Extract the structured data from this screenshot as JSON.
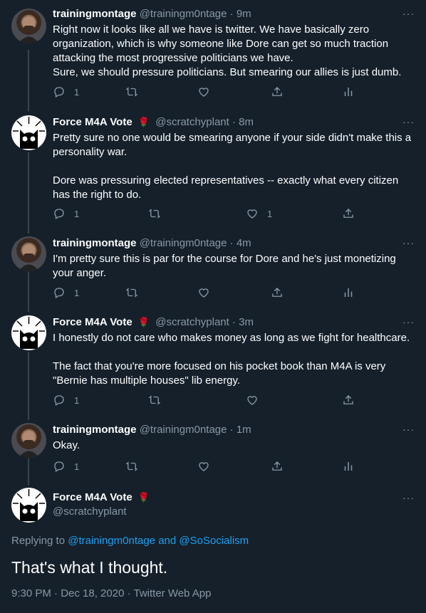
{
  "colors": {
    "background": "#15202b",
    "text": "#ffffff",
    "muted": "#8899a6",
    "link": "#1da1f2",
    "thread_line": "#38444d"
  },
  "replies": [
    {
      "name": "trainingmontage",
      "handle": "@trainingm0ntage",
      "time": "· 9m",
      "rose": "",
      "lines": [
        "Right now it looks like all we have is twitter. We have basically zero organization, which is why someone like Dore can get so much traction attacking the most progressive politicians we have.",
        "Sure, we should pressure politicians. But smearing our allies is just dumb."
      ],
      "reply_count": "1",
      "retweet_count": "",
      "like_count": ""
    },
    {
      "name": "Force M4A Vote",
      "handle": "@scratchyplant",
      "time": "· 8m",
      "rose": "🌹",
      "paragraph1": "Pretty sure no one would be smearing anyone if your side didn't make this a personality war.",
      "paragraph2": "Dore was pressuring elected representatives -- exactly what every citizen has the right to do.",
      "reply_count": "1",
      "retweet_count": "",
      "like_count": "1"
    },
    {
      "name": "trainingmontage",
      "handle": "@trainingm0ntage",
      "time": "· 4m",
      "rose": "",
      "text": "I'm pretty sure this is par for the course for Dore and he's just monetizing your anger.",
      "reply_count": "1",
      "retweet_count": "",
      "like_count": ""
    },
    {
      "name": "Force M4A Vote",
      "handle": "@scratchyplant",
      "time": "· 3m",
      "rose": "🌹",
      "paragraph1": "I honestly do not care who makes money as long as we fight for healthcare.",
      "paragraph2": "The fact that you're more focused on his pocket book than M4A is very \"Bernie has multiple houses\" lib energy.",
      "reply_count": "1",
      "retweet_count": "",
      "like_count": ""
    },
    {
      "name": "trainingmontage",
      "handle": "@trainingm0ntage",
      "time": "· 1m",
      "rose": "",
      "text": "Okay.",
      "reply_count": "1",
      "retweet_count": "",
      "like_count": ""
    }
  ],
  "main": {
    "name": "Force M4A Vote",
    "rose": "🌹",
    "handle": "@scratchyplant",
    "replying_prefix": "Replying to",
    "mention1": "@trainingm0ntage",
    "and_word": "and",
    "mention2": "@SoSocialism",
    "text": "That's what I thought.",
    "timestamp": "9:30 PM · Dec 18, 2020 · Twitter Web App"
  },
  "icons": {
    "reply": "reply-icon",
    "retweet": "retweet-icon",
    "like": "heart-icon",
    "share": "share-icon",
    "analytics": "analytics-icon",
    "more": "more-dots-icon"
  }
}
